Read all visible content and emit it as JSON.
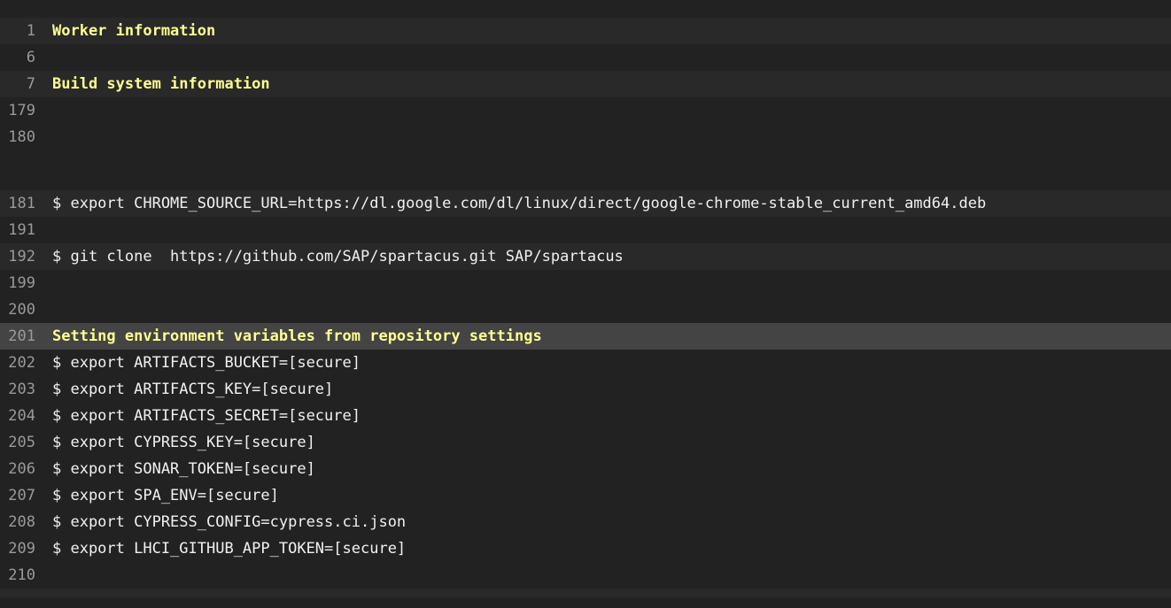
{
  "log": {
    "lines": [
      {
        "num": "1",
        "text": "Worker information",
        "kind": "section"
      },
      {
        "num": "6",
        "text": "",
        "kind": "blank"
      },
      {
        "num": "7",
        "text": "Build system information",
        "kind": "section"
      },
      {
        "num": "179",
        "text": "",
        "kind": "blank"
      },
      {
        "num": "180",
        "text": "",
        "kind": "blank"
      },
      {
        "num": "181",
        "text": "$ export CHROME_SOURCE_URL=https://dl.google.com/dl/linux/direct/google-chrome-stable_current_amd64.deb",
        "kind": "cmd"
      },
      {
        "num": "191",
        "text": "",
        "kind": "blank"
      },
      {
        "num": "192",
        "text": "$ git clone  https://github.com/SAP/spartacus.git SAP/spartacus",
        "kind": "cmd"
      },
      {
        "num": "199",
        "text": "",
        "kind": "blank"
      },
      {
        "num": "200",
        "text": "",
        "kind": "blank"
      },
      {
        "num": "201",
        "text": "Setting environment variables from repository settings",
        "kind": "section"
      },
      {
        "num": "202",
        "text": "$ export ARTIFACTS_BUCKET=[secure]",
        "kind": "cmd"
      },
      {
        "num": "203",
        "text": "$ export ARTIFACTS_KEY=[secure]",
        "kind": "cmd"
      },
      {
        "num": "204",
        "text": "$ export ARTIFACTS_SECRET=[secure]",
        "kind": "cmd"
      },
      {
        "num": "205",
        "text": "$ export CYPRESS_KEY=[secure]",
        "kind": "cmd"
      },
      {
        "num": "206",
        "text": "$ export SONAR_TOKEN=[secure]",
        "kind": "cmd"
      },
      {
        "num": "207",
        "text": "$ export SPA_ENV=[secure]",
        "kind": "cmd"
      },
      {
        "num": "208",
        "text": "$ export CYPRESS_CONFIG=cypress.ci.json",
        "kind": "cmd"
      },
      {
        "num": "209",
        "text": "$ export LHCI_GITHUB_APP_TOKEN=[secure]",
        "kind": "cmd"
      },
      {
        "num": "210",
        "text": "",
        "kind": "blank"
      }
    ]
  },
  "colors": {
    "background": "#222222",
    "fold_background": "#292929",
    "highlight_background": "#444444",
    "section_text": "#ffff91",
    "line_number": "#9a9a9a",
    "command_text": "#f1f1f1"
  }
}
